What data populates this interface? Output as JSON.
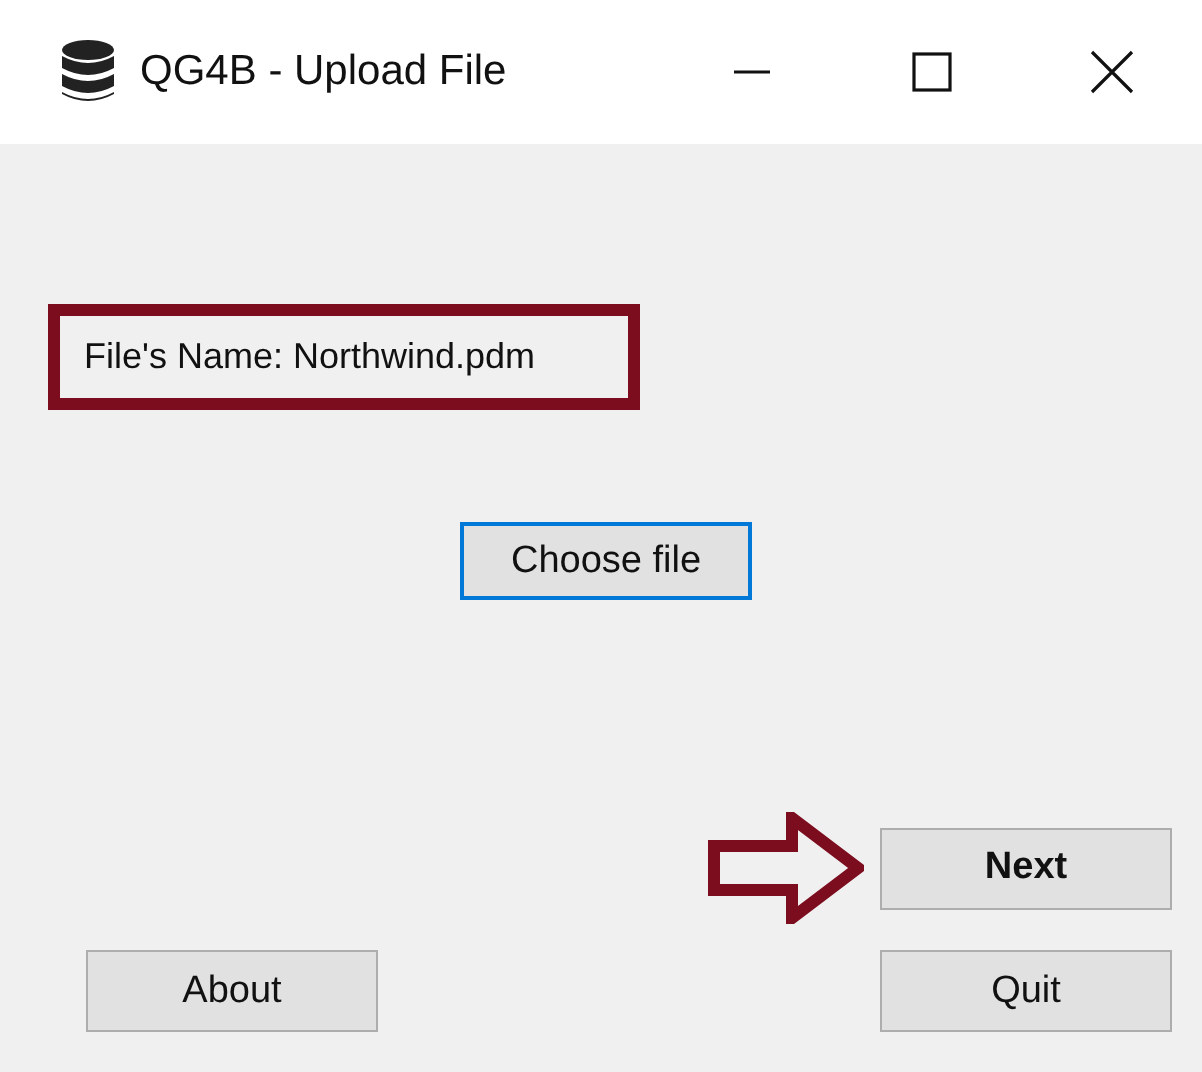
{
  "window": {
    "title": "QG4B - Upload File"
  },
  "file_label": {
    "text": "File's Name: Northwind.pdm",
    "highlighted": true
  },
  "buttons": [
    {
      "label": "Choose file",
      "kind": "choose",
      "focused": true,
      "default": false
    },
    {
      "label": "Next",
      "kind": "next",
      "focused": false,
      "default": true,
      "highlighted": true
    },
    {
      "label": "About",
      "kind": "about",
      "focused": false,
      "default": false
    },
    {
      "label": "Quit",
      "kind": "quit",
      "focused": false,
      "default": false
    }
  ]
}
